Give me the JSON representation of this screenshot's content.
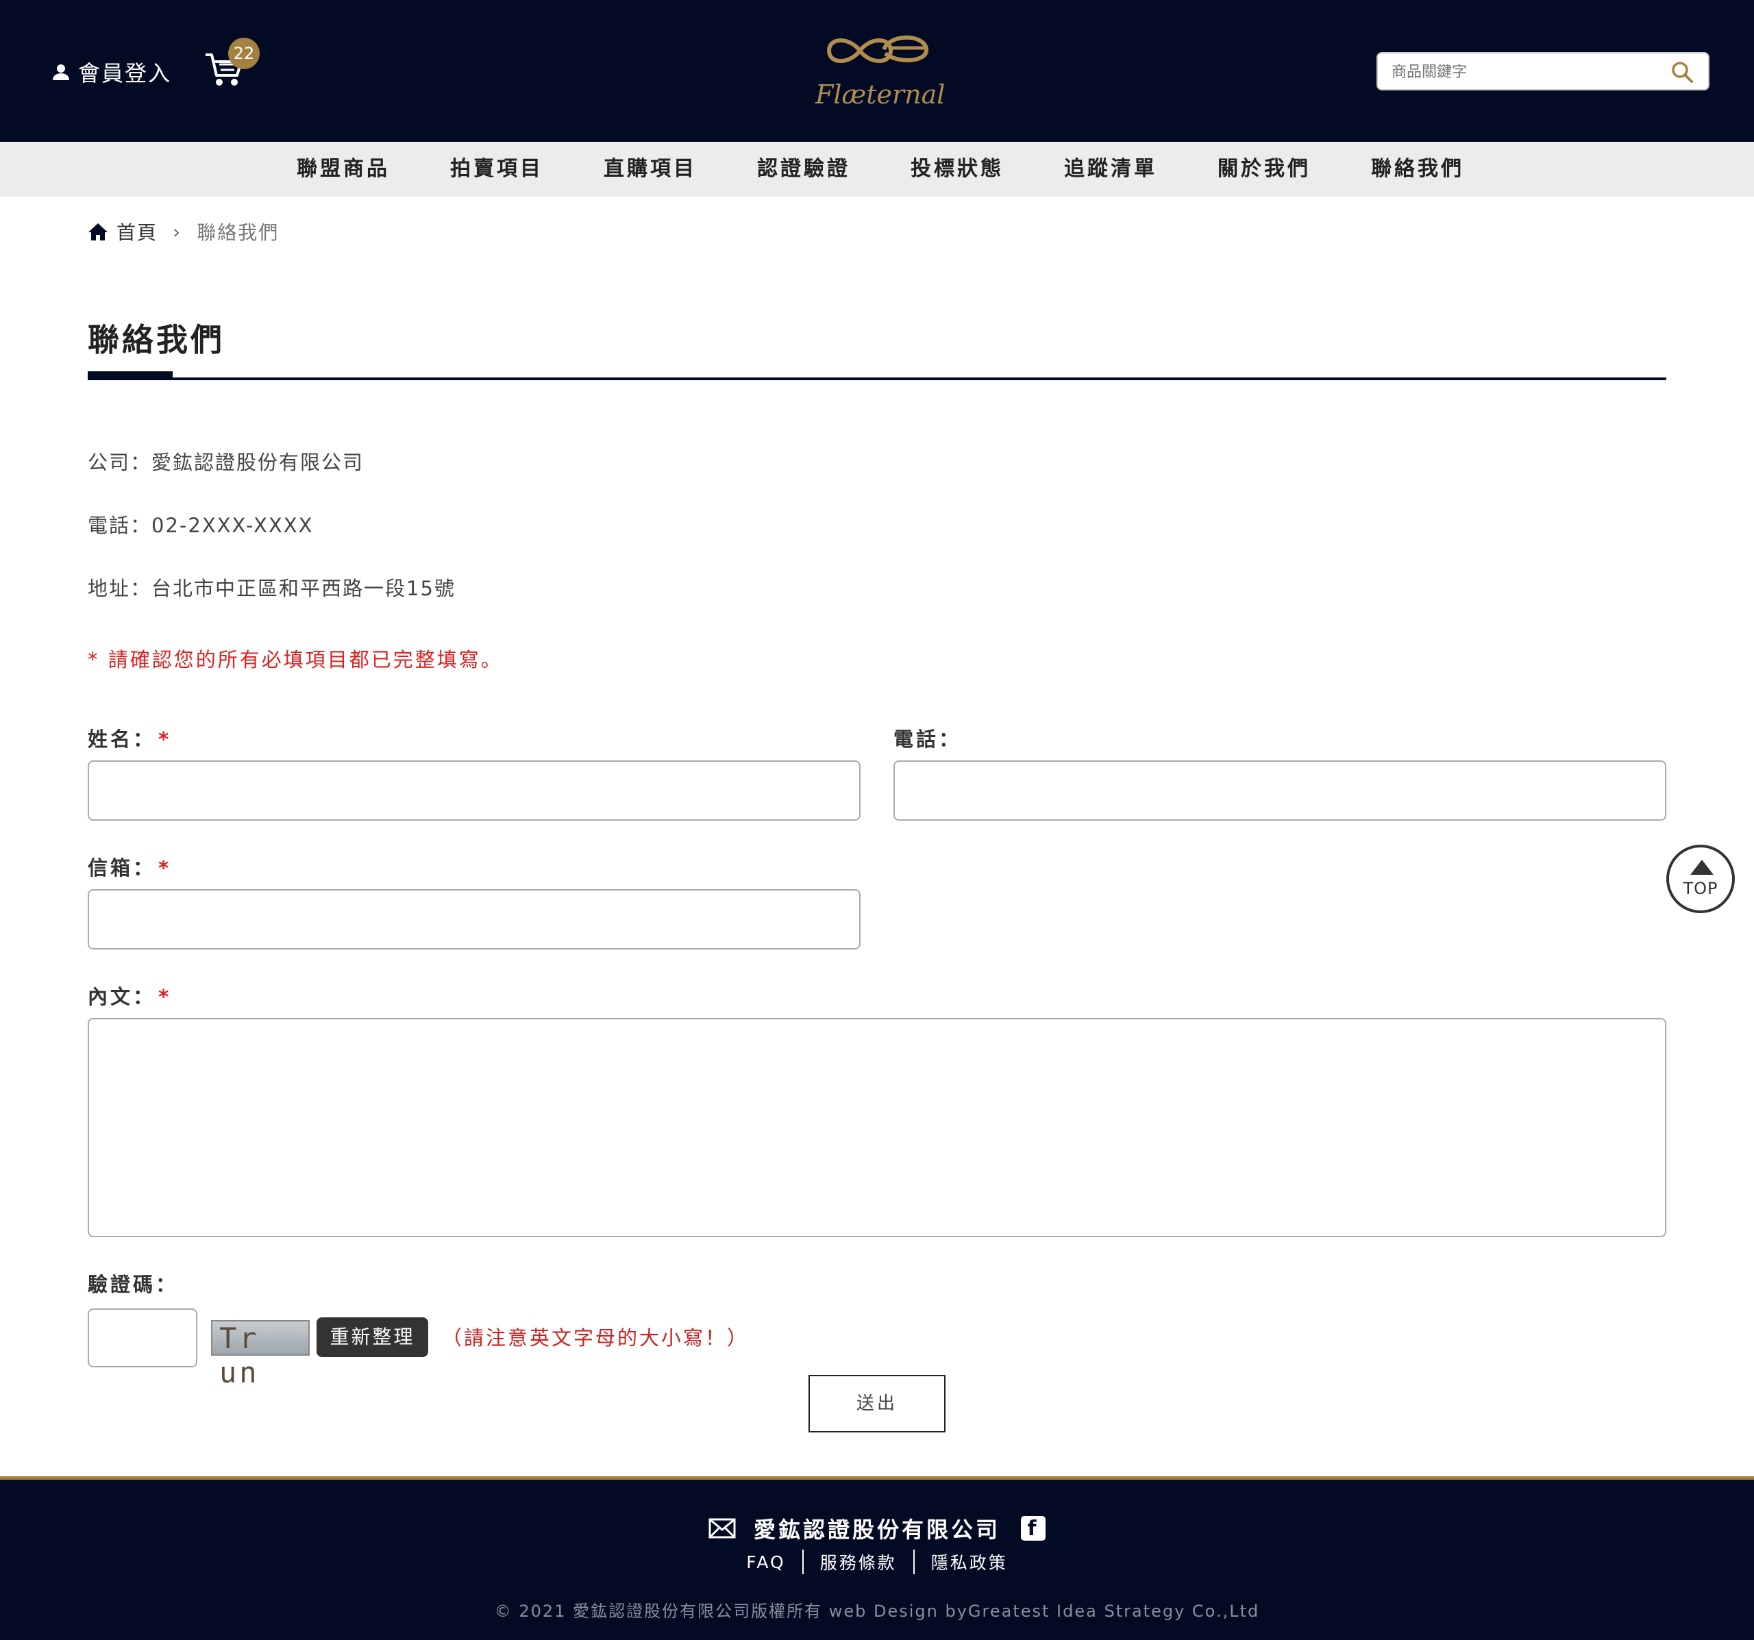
{
  "header": {
    "member_login": "會員登入",
    "cart_count": "22",
    "logo_text": "Flæternal",
    "search_placeholder": "商品關鍵字"
  },
  "nav": {
    "items": [
      "聯盟商品",
      "拍賣項目",
      "直購項目",
      "認證驗證",
      "投標狀態",
      "追蹤清單",
      "關於我們",
      "聯絡我們"
    ]
  },
  "breadcrumb": {
    "home": "首頁",
    "current": "聯絡我們"
  },
  "page": {
    "title": "聯絡我們",
    "company": "公司：愛鈜認證股份有限公司",
    "phone": "電話：02-2XXX-XXXX",
    "address": "地址：台北市中正區和平西路一段15號",
    "notice": "* 請確認您的所有必填項目都已完整填寫。"
  },
  "form": {
    "name_label": "姓名：",
    "phone_label": "電話：",
    "email_label": "信箱：",
    "content_label": "內文：",
    "required_mark": "*",
    "captcha_label": "驗證碼：",
    "captcha_text": "Tr un",
    "refresh_label": "重新整理",
    "captcha_note": "（請注意英文字母的大小寫！）",
    "submit_label": "送出"
  },
  "top_button": "TOP",
  "footer": {
    "company": "愛鈜認證股份有限公司",
    "facebook": "f",
    "links": [
      "FAQ",
      "服務條款",
      "隱私政策"
    ],
    "copyright": "© 2021 愛鈜認證股份有限公司版權所有 web Design byGreatest Idea Strategy Co.,Ltd"
  },
  "colors": {
    "navy": "#030a24",
    "gold": "#a5813f",
    "required_red": "#dd2222"
  }
}
